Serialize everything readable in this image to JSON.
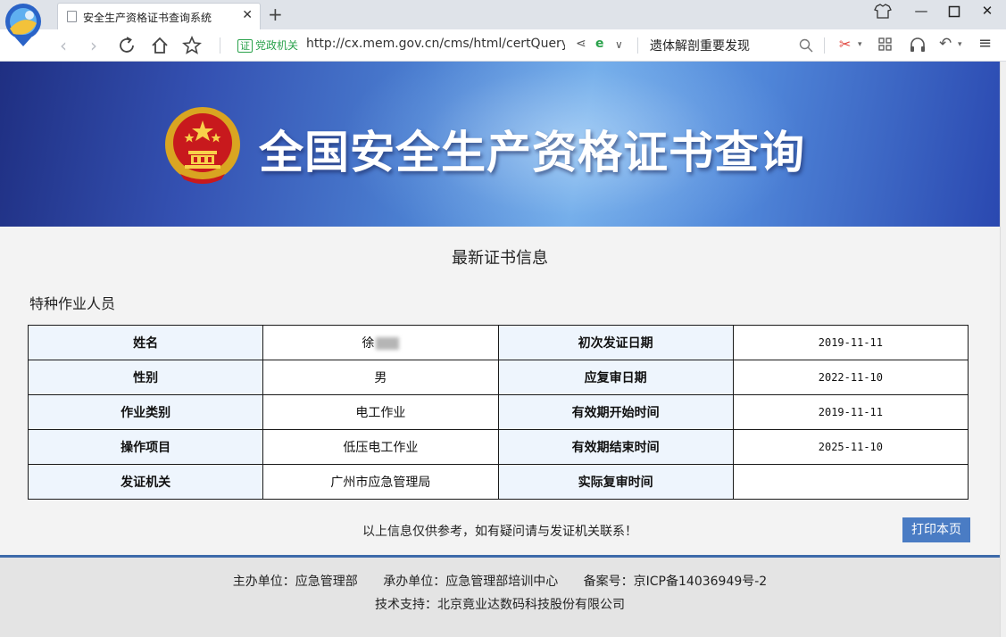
{
  "browser": {
    "tab_title": "安全生产资格证书查询系统",
    "new_tab": "+",
    "address_badge": "证",
    "address_badge_label": "党政机关",
    "url": "http://cx.mem.gov.cn/cms/html/certQuery/",
    "search_text": "遗体解剖重要发现"
  },
  "banner": {
    "title": "全国安全生产资格证书查询"
  },
  "page": {
    "section_title": "最新证书信息",
    "category": "特种作业人员",
    "rows": [
      {
        "l1": "姓名",
        "v1": "徐",
        "l2": "初次发证日期",
        "v2": "2019-11-11"
      },
      {
        "l1": "性别",
        "v1": "男",
        "l2": "应复审日期",
        "v2": "2022-11-10"
      },
      {
        "l1": "作业类别",
        "v1": "电工作业",
        "l2": "有效期开始时间",
        "v2": "2019-11-11"
      },
      {
        "l1": "操作项目",
        "v1": "低压电工作业",
        "l2": "有效期结束时间",
        "v2": "2025-11-10"
      },
      {
        "l1": "发证机关",
        "v1": "广州市应急管理局",
        "l2": "实际复审时间",
        "v2": ""
      }
    ],
    "notice": "以上信息仅供参考，如有疑问请与发证机关联系！",
    "print_label": "打印本页"
  },
  "footer": {
    "host": "主办单位：应急管理部",
    "organizer": "承办单位：应急管理部培训中心",
    "icp": "备案号：京ICP备14036949号-2",
    "support": "技术支持：北京竟业达数码科技股份有限公司"
  },
  "colors": {
    "label_cell_bg": "#eef5fd",
    "print_button": "#4a7cc4",
    "footer_rule": "#3d6aaa",
    "secure_badge": "#2aa24b"
  }
}
